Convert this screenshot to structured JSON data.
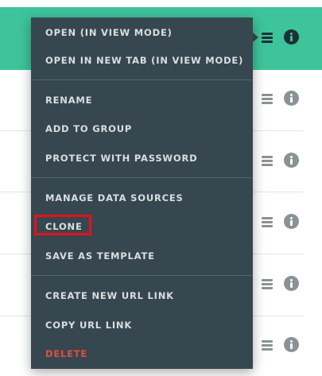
{
  "context_menu": {
    "items": [
      {
        "label": "OPEN (IN VIEW MODE)"
      },
      {
        "label": "OPEN IN NEW TAB (IN VIEW MODE)"
      },
      {
        "label": "RENAME"
      },
      {
        "label": "ADD TO GROUP"
      },
      {
        "label": "PROTECT WITH PASSWORD"
      },
      {
        "label": "MANAGE DATA SOURCES"
      },
      {
        "label": "CLONE"
      },
      {
        "label": "SAVE AS TEMPLATE"
      },
      {
        "label": "CREATE NEW URL LINK"
      },
      {
        "label": "COPY URL LINK"
      },
      {
        "label": "DELETE"
      }
    ],
    "highlighted_item": "CLONE"
  },
  "row_icons": [
    "hamburger-menu-icon",
    "info-icon"
  ],
  "colors": {
    "active_row": "#3ec49a",
    "menu_background": "#37474f",
    "menu_text": "#d9dee0",
    "delete_text": "#e04e40",
    "highlight_border": "#e8101a"
  }
}
